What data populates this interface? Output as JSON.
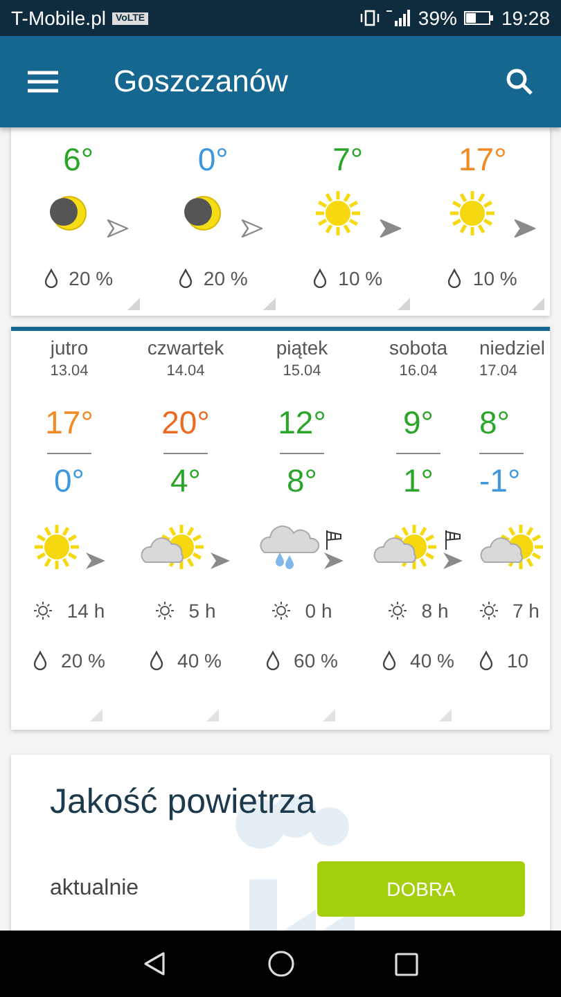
{
  "status_bar": {
    "carrier": "T-Mobile.pl",
    "volte": "VoLTE",
    "battery": "39%",
    "time": "19:28"
  },
  "app_bar": {
    "title": "Goszczanów"
  },
  "hourly": [
    {
      "temp": "6°",
      "color": "#2aa52a",
      "kind": "moon",
      "wind_light": true,
      "rain": "20 %"
    },
    {
      "temp": "0°",
      "color": "#3d97de",
      "kind": "moon",
      "wind_light": true,
      "rain": "20 %"
    },
    {
      "temp": "7°",
      "color": "#2aa52a",
      "kind": "sun",
      "wind_light": false,
      "rain": "10 %"
    },
    {
      "temp": "17°",
      "color": "#f08a24",
      "kind": "sun",
      "wind_light": false,
      "rain": "10 %"
    }
  ],
  "daily": [
    {
      "day": "jutro",
      "date": "13.04",
      "high": {
        "text": "17°",
        "color": "#f08a24"
      },
      "low": {
        "text": "0°",
        "color": "#3d97de"
      },
      "kind": "sun",
      "windy": false,
      "sun_hours": "14 h",
      "rain": "20 %"
    },
    {
      "day": "czwartek",
      "date": "14.04",
      "high": {
        "text": "20°",
        "color": "#ea6a22"
      },
      "low": {
        "text": "4°",
        "color": "#2aa52a"
      },
      "kind": "sun_cloud",
      "windy": false,
      "sun_hours": "5 h",
      "rain": "40 %"
    },
    {
      "day": "piątek",
      "date": "15.04",
      "high": {
        "text": "12°",
        "color": "#2aa52a"
      },
      "low": {
        "text": "8°",
        "color": "#2aa52a"
      },
      "kind": "rain_cloud",
      "windy": true,
      "sun_hours": "0 h",
      "rain": "60 %"
    },
    {
      "day": "sobota",
      "date": "16.04",
      "high": {
        "text": "9°",
        "color": "#2aa52a"
      },
      "low": {
        "text": "1°",
        "color": "#2aa52a"
      },
      "kind": "sun_cloud",
      "windy": true,
      "sun_hours": "8 h",
      "rain": "40 %"
    },
    {
      "day": "niedziel",
      "date": "17.04",
      "high": {
        "text": "8°",
        "color": "#2aa52a"
      },
      "low": {
        "text": "-1°",
        "color": "#3d97de"
      },
      "kind": "sun_cloud",
      "windy": false,
      "sun_hours": "7 h",
      "rain": "10"
    }
  ],
  "air_quality": {
    "title": "Jakość powietrza",
    "label": "aktualnie",
    "value": "DOBRA",
    "color": "#a4cf0c"
  }
}
